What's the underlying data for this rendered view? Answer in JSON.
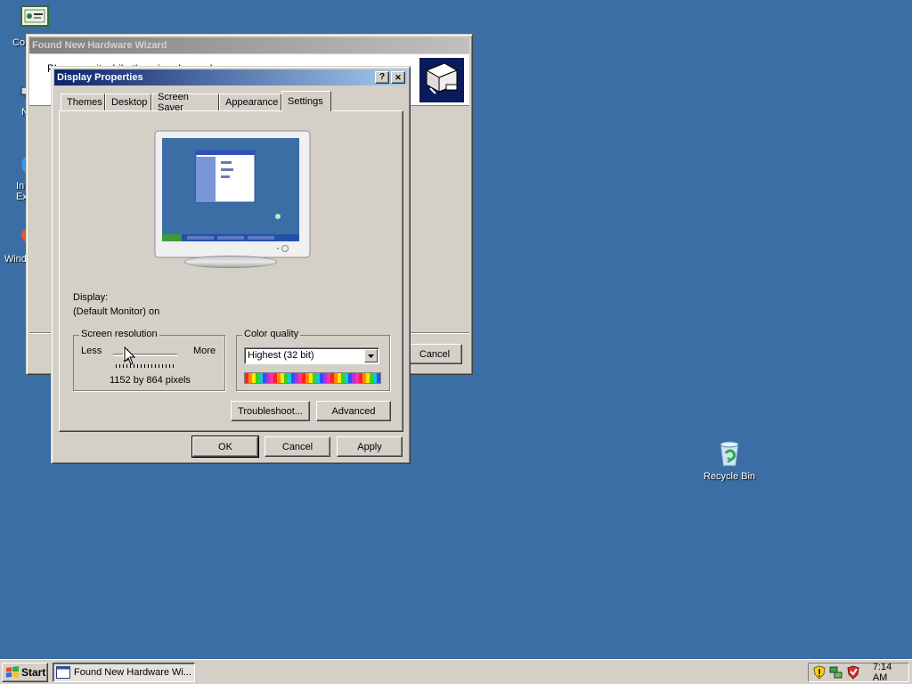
{
  "desktop": {
    "icons": [
      {
        "label": "Co",
        "icon": "computer-icon"
      },
      {
        "label": "N",
        "icon": "network-icon"
      },
      {
        "label": "In Ex",
        "icon": "internet-explorer-icon"
      },
      {
        "label": "Windo P",
        "icon": "windows-media-player-icon"
      }
    ],
    "recycle_bin": {
      "label": "Recycle Bin",
      "icon": "recycle-bin-icon"
    }
  },
  "wizard": {
    "title": "Found New Hardware Wizard",
    "body_text": "Please wait while the wizard searches...",
    "cancel_label": "Cancel"
  },
  "display_properties": {
    "title": "Display Properties",
    "help_label": "?",
    "close_label": "✕",
    "tabs": [
      "Themes",
      "Desktop",
      "Screen Saver",
      "Appearance",
      "Settings"
    ],
    "active_tab": "Settings",
    "display_label": "Display:",
    "display_value": "(Default Monitor) on",
    "resolution": {
      "legend": "Screen resolution",
      "less": "Less",
      "more": "More",
      "value_text": "1152 by 864 pixels"
    },
    "color": {
      "legend": "Color quality",
      "selected": "Highest (32 bit)"
    },
    "buttons": {
      "troubleshoot": "Troubleshoot...",
      "advanced": "Advanced",
      "ok": "OK",
      "cancel": "Cancel",
      "apply": "Apply"
    }
  },
  "taskbar": {
    "start_label": "Start",
    "task_label": "Found New Hardware Wi...",
    "clock": "7:14 AM"
  },
  "colors": {
    "desktop": "#3a6ea5",
    "title_active": "#0a246a",
    "face": "#d4d0c8"
  }
}
